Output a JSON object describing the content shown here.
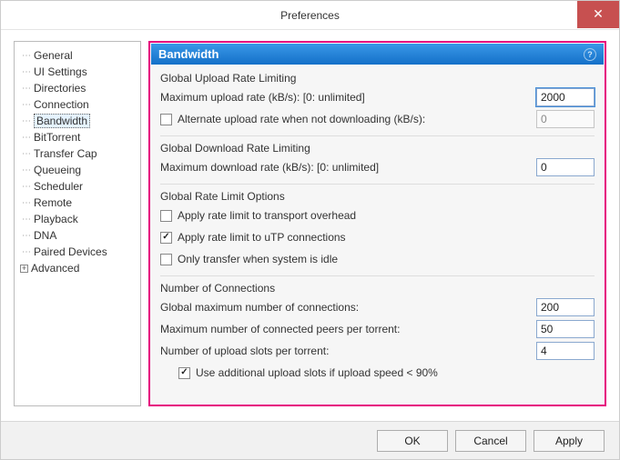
{
  "window": {
    "title": "Preferences"
  },
  "sidebar": {
    "items": [
      {
        "label": "General"
      },
      {
        "label": "UI Settings"
      },
      {
        "label": "Directories"
      },
      {
        "label": "Connection"
      },
      {
        "label": "Bandwidth",
        "selected": true
      },
      {
        "label": "BitTorrent"
      },
      {
        "label": "Transfer Cap"
      },
      {
        "label": "Queueing"
      },
      {
        "label": "Scheduler"
      },
      {
        "label": "Remote"
      },
      {
        "label": "Playback"
      },
      {
        "label": "DNA"
      },
      {
        "label": "Paired Devices"
      },
      {
        "label": "Advanced",
        "expandable": true
      }
    ]
  },
  "header": {
    "title": "Bandwidth"
  },
  "upload": {
    "group_title": "Global Upload Rate Limiting",
    "max_label": "Maximum upload rate (kB/s): [0: unlimited]",
    "max_value": "2000",
    "alt_label": "Alternate upload rate when not downloading (kB/s):",
    "alt_checked": false,
    "alt_value": "0"
  },
  "download": {
    "group_title": "Global Download Rate Limiting",
    "max_label": "Maximum download rate (kB/s): [0: unlimited]",
    "max_value": "0"
  },
  "options": {
    "group_title": "Global Rate Limit Options",
    "overhead_label": "Apply rate limit to transport overhead",
    "overhead_checked": false,
    "utp_label": "Apply rate limit to uTP connections",
    "utp_checked": true,
    "idle_label": "Only transfer when system is idle",
    "idle_checked": false
  },
  "connections": {
    "group_title": "Number of Connections",
    "global_max_label": "Global maximum number of connections:",
    "global_max_value": "200",
    "peers_label": "Maximum number of connected peers per torrent:",
    "peers_value": "50",
    "slots_label": "Number of upload slots per torrent:",
    "slots_value": "4",
    "extra_slots_label": "Use additional upload slots if upload speed < 90%",
    "extra_slots_checked": true
  },
  "buttons": {
    "ok": "OK",
    "cancel": "Cancel",
    "apply": "Apply"
  }
}
